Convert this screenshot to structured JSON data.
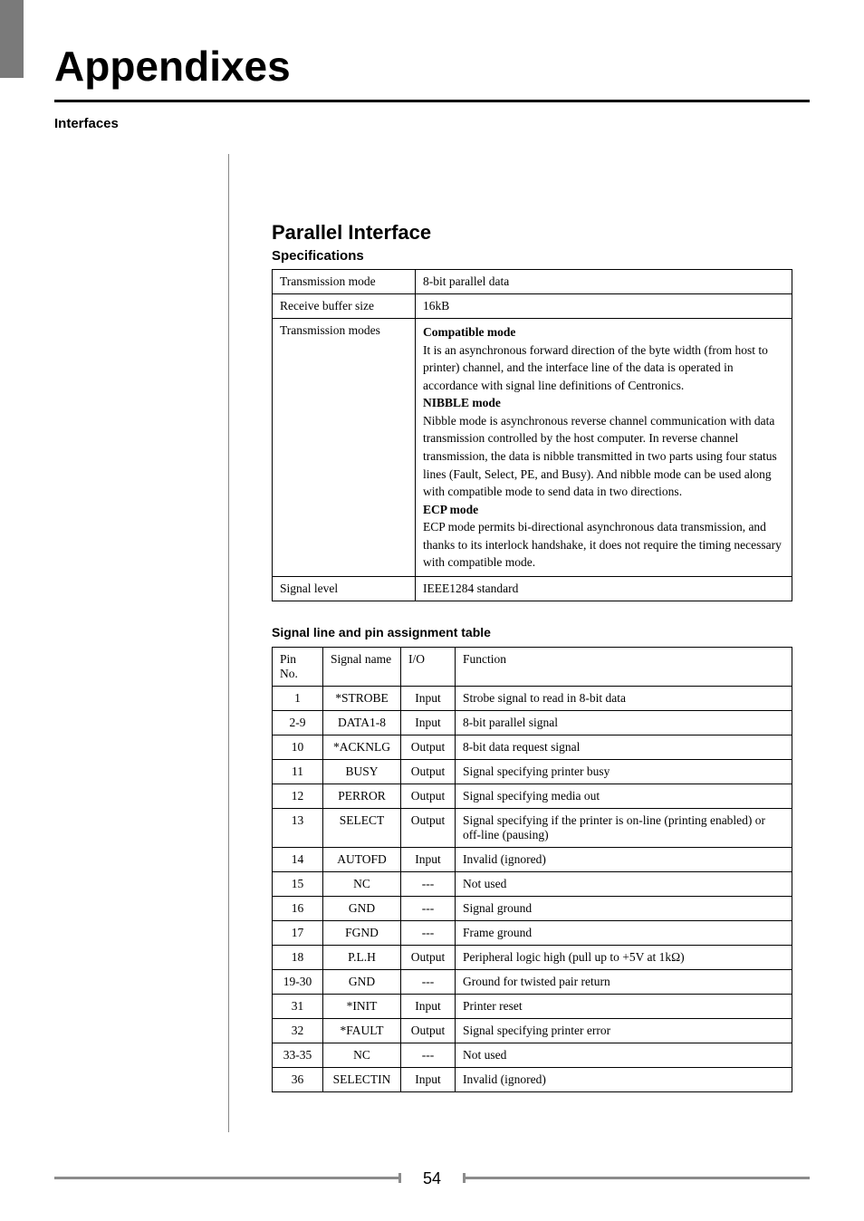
{
  "chapter_title": "Appendixes",
  "margin_label": "Interfaces",
  "section_title": "Parallel Interface",
  "spec_heading": "Specifications",
  "spec_rows": {
    "transmission_mode_label": "Transmission mode",
    "transmission_mode_value": "8-bit parallel data",
    "receive_buffer_label": "Receive buffer size",
    "receive_buffer_value": "16kB",
    "transmission_modes_label": "Transmission modes",
    "signal_level_label": "Signal level",
    "signal_level_value": "IEEE1284 standard"
  },
  "modes": {
    "compatible": {
      "name": "Compatible mode",
      "text": "It is an asynchronous forward direction of the byte width (from host to printer) channel, and the interface line of the data is operated in accordance with signal line definitions of Centronics."
    },
    "nibble": {
      "name": "NIBBLE mode",
      "text": "Nibble mode is asynchronous reverse channel communication with data transmission controlled by the host computer. In reverse channel transmission, the data is nibble transmitted in two parts using four status lines (Fault, Select, PE, and Busy). And nibble mode can be used along with compatible mode to send data in two directions."
    },
    "ecp": {
      "name": "ECP mode",
      "text": "ECP mode permits bi-directional asynchronous data transmission, and thanks to its interlock handshake, it does not require the timing necessary with compatible mode."
    }
  },
  "pin_heading": "Signal line and pin assignment table",
  "pin_headers": {
    "pin": "Pin No.",
    "signal": "Signal name",
    "io": "I/O",
    "func": "Function"
  },
  "pins": [
    {
      "pin": "1",
      "signal": "*STROBE",
      "io": "Input",
      "func": "Strobe signal to read in 8-bit data"
    },
    {
      "pin": "2-9",
      "signal": "DATA1-8",
      "io": "Input",
      "func": "8-bit parallel signal"
    },
    {
      "pin": "10",
      "signal": "*ACKNLG",
      "io": "Output",
      "func": "8-bit data request signal"
    },
    {
      "pin": "11",
      "signal": "BUSY",
      "io": "Output",
      "func": "Signal specifying printer busy"
    },
    {
      "pin": "12",
      "signal": "PERROR",
      "io": "Output",
      "func": "Signal specifying media out"
    },
    {
      "pin": "13",
      "signal": "SELECT",
      "io": "Output",
      "func": "Signal specifying if the printer is on-line (printing enabled) or off-line (pausing)"
    },
    {
      "pin": "14",
      "signal": "AUTOFD",
      "io": "Input",
      "func": "Invalid (ignored)"
    },
    {
      "pin": "15",
      "signal": "NC",
      "io": "---",
      "func": "Not used"
    },
    {
      "pin": "16",
      "signal": "GND",
      "io": "---",
      "func": "Signal ground"
    },
    {
      "pin": "17",
      "signal": "FGND",
      "io": "---",
      "func": "Frame ground"
    },
    {
      "pin": "18",
      "signal": "P.L.H",
      "io": "Output",
      "func": "Peripheral logic high (pull up to +5V at 1kΩ)"
    },
    {
      "pin": "19-30",
      "signal": "GND",
      "io": "---",
      "func": "Ground for twisted pair return"
    },
    {
      "pin": "31",
      "signal": "*INIT",
      "io": "Input",
      "func": "Printer reset"
    },
    {
      "pin": "32",
      "signal": "*FAULT",
      "io": "Output",
      "func": "Signal specifying printer error"
    },
    {
      "pin": "33-35",
      "signal": "NC",
      "io": "---",
      "func": "Not used"
    },
    {
      "pin": "36",
      "signal": "SELECTIN",
      "io": "Input",
      "func": "Invalid (ignored)"
    }
  ],
  "page_number": "54"
}
